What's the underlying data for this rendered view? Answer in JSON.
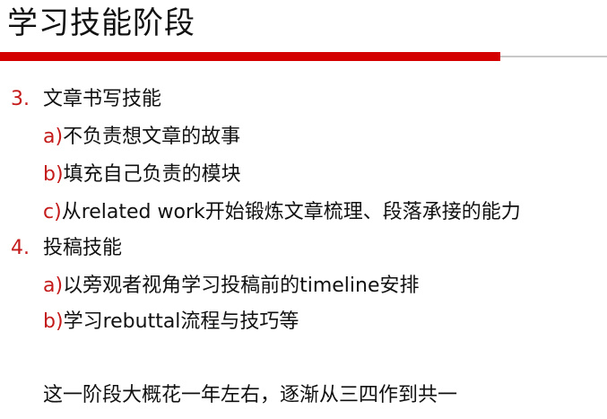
{
  "title": "学习技能阶段",
  "colors": {
    "accent_rule": "#d40000",
    "marker": "#c41a1a",
    "text": "#111111"
  },
  "items": [
    {
      "marker": "3.",
      "text": "文章书写技能",
      "subitems": [
        {
          "marker": "a)",
          "text": "不负责想文章的故事"
        },
        {
          "marker": "b)",
          "text": "填充自己负责的模块"
        },
        {
          "marker": "c)",
          "text": "从related work开始锻炼文章梳理、段落承接的能力"
        }
      ]
    },
    {
      "marker": "4.",
      "text": "投稿技能",
      "subitems": [
        {
          "marker": "a)",
          "text": "以旁观者视角学习投稿前的timeline安排"
        },
        {
          "marker": "b)",
          "text": "学习rebuttal流程与技巧等"
        }
      ]
    }
  ],
  "summary": "这一阶段大概花一年左右，逐渐从三四作到共一"
}
